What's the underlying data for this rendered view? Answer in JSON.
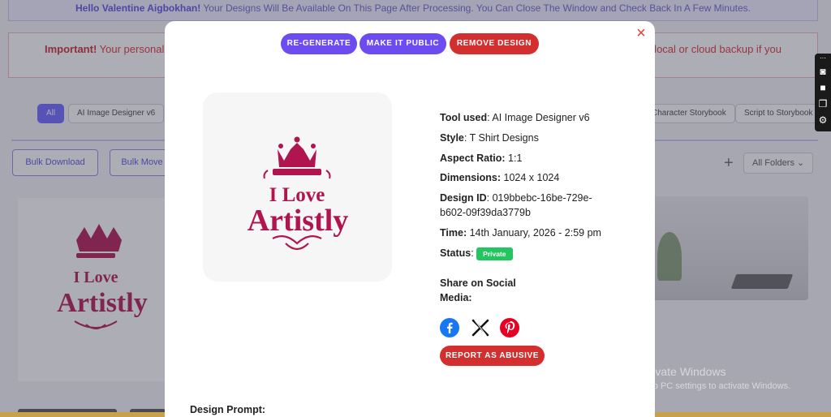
{
  "background": {
    "hello_name": "Hello Valentine Aigbokhan!",
    "hello_msg": " Your Designs Will Be Available On This Page After Processing. You Can Close The Window and Check Back In A Few Minutes.",
    "important_label": "Important!",
    "important_msg": " Your personal c",
    "important_right": "a local or cloud backup if you",
    "filters": [
      "All",
      "AI Image Designer v6",
      "Character Storybook",
      "Script to Storybook"
    ],
    "bulk_download": "Bulk Download",
    "bulk_move": "Bulk Move",
    "all_folders": "All Folders",
    "plus": "+",
    "card_logo": {
      "line1": "I Love",
      "line2": "Artistly"
    }
  },
  "modal": {
    "actions": {
      "regenerate": "RE-GENERATE",
      "make_public": "MAKE IT PUBLIC",
      "remove": "REMOVE DESIGN"
    },
    "close_glyph": "×",
    "logo": {
      "line1": "I Love",
      "line2": "Artistly"
    },
    "details": {
      "tool_label": "Tool used",
      "tool_value": ": AI Image Designer v6",
      "style_label": "Style",
      "style_value": ": T Shirt Designs",
      "aspect_label": "Aspect Ratio:",
      "aspect_value": " 1:1",
      "dimensions_label": "Dimensions:",
      "dimensions_value": " 1024 x 1024",
      "design_id_label": "Design ID",
      "design_id_value": ": 019bbebc-16be-729e-",
      "design_id_value2": "b602-09f39da3779b",
      "time_label": "Time:",
      "time_value": " 14th January, 2026 - 2:59 pm",
      "status_label": "Status",
      "status_colon": ": ",
      "status_value": "Private"
    },
    "share_title_1": "Share on Social",
    "share_title_2": "Media:",
    "report_label": "REPORT AS ABUSIVE",
    "prompt_label": "Design Prompt:"
  },
  "windows_watermark": {
    "line1": "Activate Windows",
    "line2": "Go to PC settings to activate Windows."
  },
  "colors": {
    "purple": "#6c4cf1",
    "red": "#d32f2f",
    "green": "#22c55e",
    "logo": "#b0154f",
    "facebook": "#1877f2",
    "pinterest": "#e60023"
  }
}
